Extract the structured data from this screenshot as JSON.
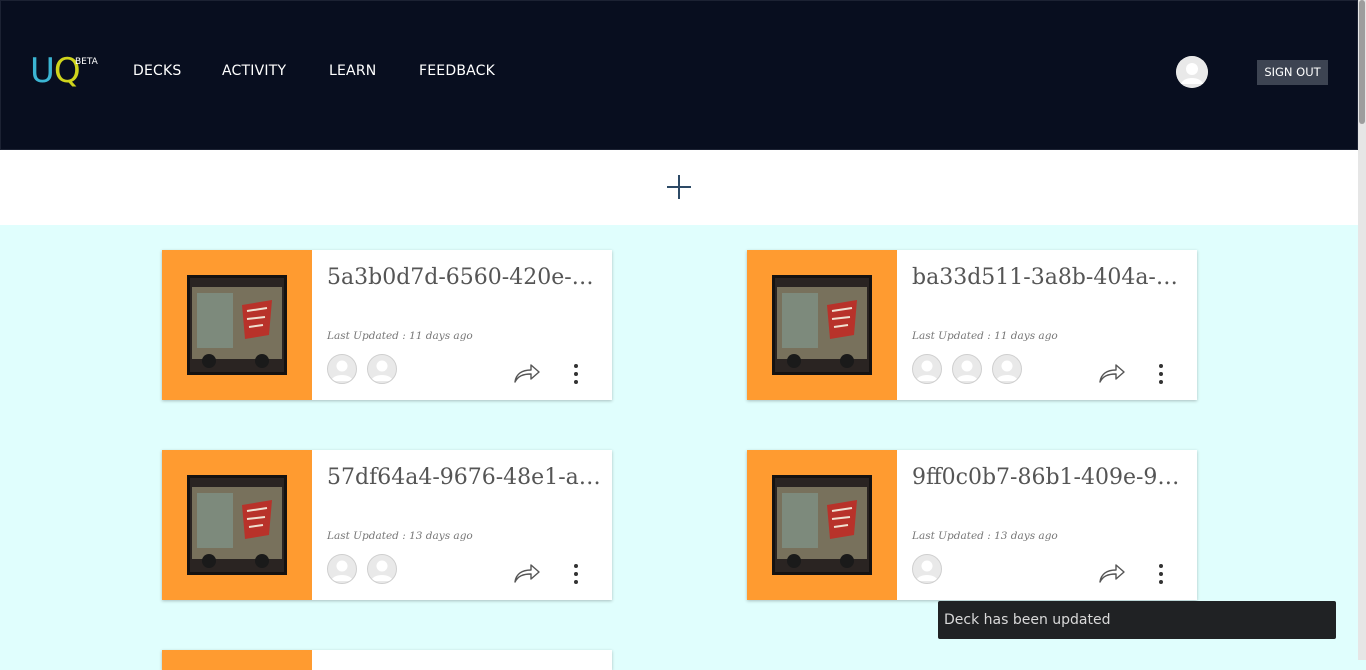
{
  "header": {
    "logo": {
      "letter1": "U",
      "letter2": "Q",
      "badge": "BETA"
    },
    "nav": [
      {
        "label": "DECKS"
      },
      {
        "label": "ACTIVITY"
      },
      {
        "label": "LEARN"
      },
      {
        "label": "FEEDBACK"
      }
    ],
    "signout_label": "SIGN OUT"
  },
  "add_button_icon": "plus-icon",
  "decks": [
    {
      "title": "5a3b0d7d-6560-420e-…",
      "updated": "Last Updated : 11 days ago",
      "collaborators": 2
    },
    {
      "title": "ba33d511-3a8b-404a-b…",
      "updated": "Last Updated : 11 days ago",
      "collaborators": 3
    },
    {
      "title": "57df64a4-9676-48e1-a…",
      "updated": "Last Updated : 13 days ago",
      "collaborators": 2
    },
    {
      "title": "9ff0c0b7-86b1-409e-9f…",
      "updated": "Last Updated : 13 days ago",
      "collaborators": 1
    }
  ],
  "toast": {
    "message": "Deck has been updated"
  },
  "colors": {
    "header_bg": "#080e1f",
    "page_bg": "#e0fefd",
    "card_accent": "#ff9b30",
    "logo_u": "#3bb5d3",
    "logo_q": "#cfd41c"
  }
}
